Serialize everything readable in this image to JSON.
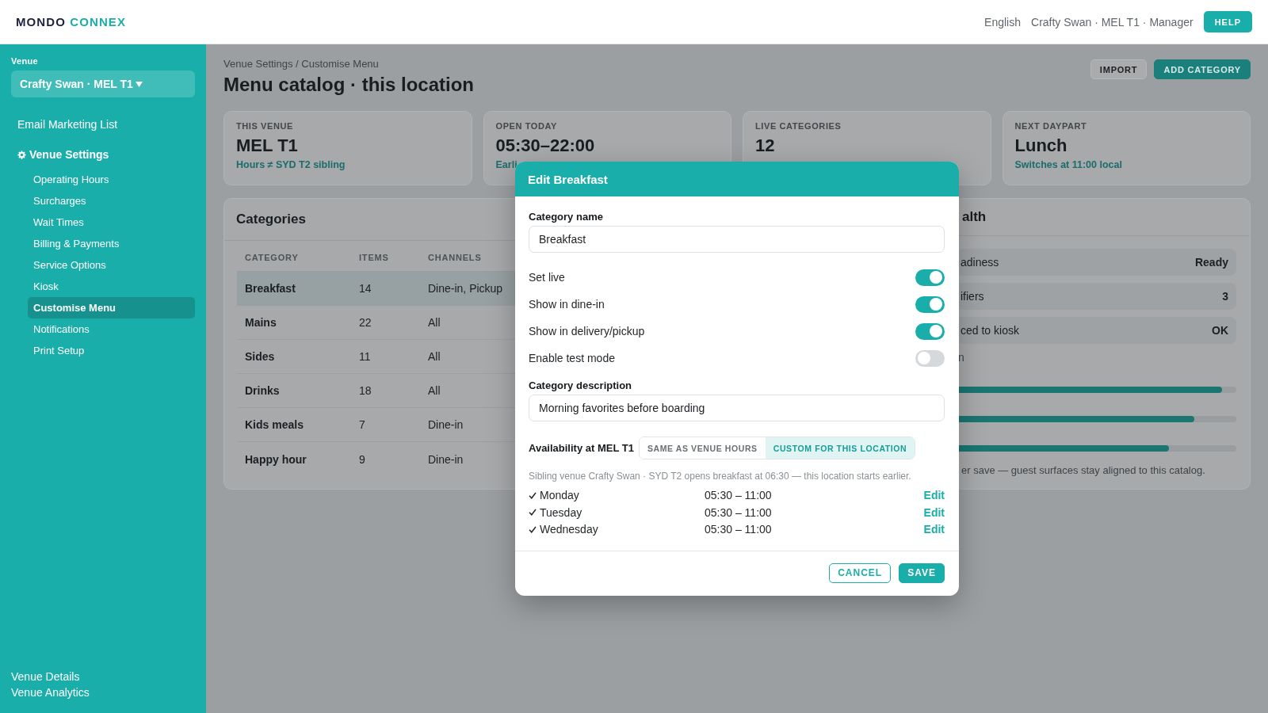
{
  "topbar": {
    "logo": {
      "primary": "MONDO",
      "accent": "CONNEX"
    },
    "language": "English",
    "user": "Crafty Swan · MEL T1 · Manager",
    "help": "HELP"
  },
  "sidebar": {
    "venue_label": "Venue",
    "venue_select": "Crafty Swan · MEL T1",
    "items": [
      {
        "kind": "link",
        "label": "Email Marketing List",
        "selected": false
      },
      {
        "kind": "group",
        "label": "Venue Settings",
        "selected": false,
        "children": [
          {
            "label": "Operating Hours",
            "selected": false
          },
          {
            "label": "Surcharges",
            "selected": false
          },
          {
            "label": "Wait Times",
            "selected": false
          },
          {
            "label": "Billing & Payments",
            "selected": false
          },
          {
            "label": "Service Options",
            "selected": false
          },
          {
            "label": "Kiosk",
            "selected": false
          },
          {
            "label": "Customise Menu",
            "selected": true
          },
          {
            "label": "Notifications",
            "selected": false
          },
          {
            "label": "Print Setup",
            "selected": false
          }
        ]
      }
    ],
    "footer_links": [
      "Venue Details",
      "Venue Analytics"
    ]
  },
  "page_header": {
    "breadcrumb": "Venue Settings / Customise Menu",
    "title": "Menu catalog · this location",
    "actions": [
      {
        "kind": "import",
        "label": "IMPORT"
      },
      {
        "kind": "add",
        "label": "ADD CATEGORY"
      }
    ]
  },
  "stats": [
    {
      "label": "THIS VENUE",
      "value": "MEL T1",
      "note": "Hours ≠ SYD T2 sibling"
    },
    {
      "label": "OPEN TODAY",
      "value": "05:30–22:00",
      "note": "Earli"
    },
    {
      "label": "LIVE CATEGORIES",
      "value": "12"
    },
    {
      "label": "NEXT DAYPART",
      "value": "Lunch",
      "note": "Switches at 11:00 local"
    }
  ],
  "categories": {
    "title": "Categories",
    "columns": [
      "CATEGORY",
      "ITEMS",
      "CHANNELS"
    ],
    "rows": [
      {
        "cells": [
          "Breakfast",
          "14",
          "Dine-in, Pickup"
        ],
        "selected": true
      },
      {
        "cells": [
          "Mains",
          "22",
          "All"
        ],
        "selected": false
      },
      {
        "cells": [
          "Sides",
          "11",
          "All"
        ],
        "selected": false
      },
      {
        "cells": [
          "Drinks",
          "18",
          "All"
        ],
        "selected": false
      },
      {
        "cells": [
          "Kids meals",
          "7",
          "Dine-in"
        ],
        "selected": false
      },
      {
        "cells": [
          "Happy hour",
          "9",
          "Dine-in"
        ],
        "selected": false
      }
    ]
  },
  "health": {
    "title": "alth",
    "rows": [
      {
        "label": "adiness",
        "value": "Ready"
      },
      {
        "label": "ifiers",
        "value": "3"
      },
      {
        "label": "ced to kiosk",
        "value": "OK"
      }
    ],
    "section_label": "n",
    "meters": [
      {
        "level": 0.95
      },
      {
        "level": 0.85
      },
      {
        "level": 0.76
      }
    ],
    "note": "er save — guest surfaces stay aligned to this catalog."
  },
  "modal": {
    "title": "Edit Breakfast",
    "name_field": {
      "label": "Category name",
      "value": "Breakfast"
    },
    "toggles": [
      {
        "label": "Set live",
        "on": true
      },
      {
        "label": "Show in dine-in",
        "on": true
      },
      {
        "label": "Show in delivery/pickup",
        "on": true
      },
      {
        "label": "Enable test mode",
        "on": false
      }
    ],
    "description_field": {
      "label": "Category description",
      "value": "Morning favorites before boarding"
    },
    "availability": {
      "label": "Availability at MEL T1",
      "options": [
        {
          "label": "SAME AS VENUE HOURS",
          "selected": false
        },
        {
          "label": "CUSTOM FOR THIS LOCATION",
          "selected": true
        }
      ],
      "note": "Sibling venue Crafty Swan · SYD T2 opens breakfast at 06:30 — this location starts earlier.",
      "days": [
        {
          "day": "Monday",
          "hours": "05:30 – 11:00",
          "checked": true,
          "action": "Edit"
        },
        {
          "day": "Tuesday",
          "hours": "05:30 – 11:00",
          "checked": true,
          "action": "Edit"
        },
        {
          "day": "Wednesday",
          "hours": "05:30 – 11:00",
          "checked": true,
          "action": "Edit"
        }
      ]
    },
    "buttons": [
      {
        "kind": "cancel",
        "label": "CANCEL"
      },
      {
        "kind": "save",
        "label": "SAVE"
      }
    ]
  }
}
